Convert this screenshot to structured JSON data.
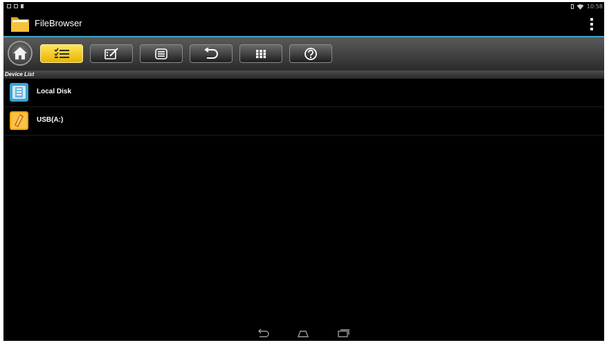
{
  "app": {
    "title": "FileBrowser"
  },
  "status_bar": {
    "time": "10:58"
  },
  "section_header": "Device List",
  "devices": [
    {
      "label": "Local Disk",
      "icon": "disk-icon"
    },
    {
      "label": "USB(A:)",
      "icon": "usb-icon"
    }
  ],
  "toolbar": [
    {
      "name": "home-button",
      "icon": "home-icon"
    },
    {
      "name": "select-button",
      "icon": "checklist-icon",
      "active": true
    },
    {
      "name": "edit-button",
      "icon": "edit-icon"
    },
    {
      "name": "list-button",
      "icon": "list-icon"
    },
    {
      "name": "back-button",
      "icon": "undo-icon"
    },
    {
      "name": "grid-button",
      "icon": "grid-icon"
    },
    {
      "name": "help-button",
      "icon": "help-icon"
    }
  ],
  "colors": {
    "accent": "#3aa7c9",
    "active_button": "#f5c800",
    "background": "#000000"
  }
}
